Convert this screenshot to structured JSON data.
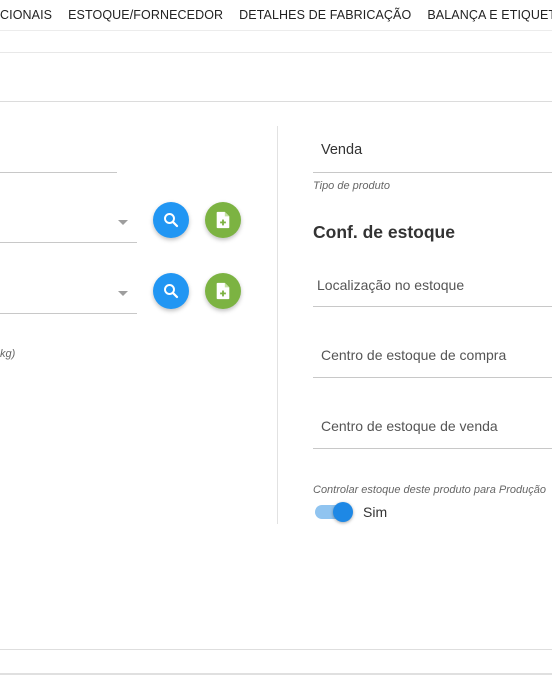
{
  "tabs": [
    {
      "label": "CIONAIS"
    },
    {
      "label": "ESTOQUE/FORNECEDOR"
    },
    {
      "label": "DETALHES DE FABRICAÇÃO"
    },
    {
      "label": "BALANÇA E ETIQUETAS"
    }
  ],
  "left": {
    "weight_hint": "kg)"
  },
  "right": {
    "product_type_value": "Venda",
    "product_type_caption": "Tipo de produto",
    "section_title": "Conf. de estoque",
    "stock_location_label": "Localização no estoque",
    "purchase_center_label": "Centro de estoque de compra",
    "sale_center_label": "Centro de estoque de venda",
    "control_caption": "Controlar estoque deste produto para Produção",
    "control_value": "Sim"
  },
  "colors": {
    "search_button": "#2196f3",
    "add_button": "#7cb342",
    "toggle_on": "#1e88e5"
  }
}
